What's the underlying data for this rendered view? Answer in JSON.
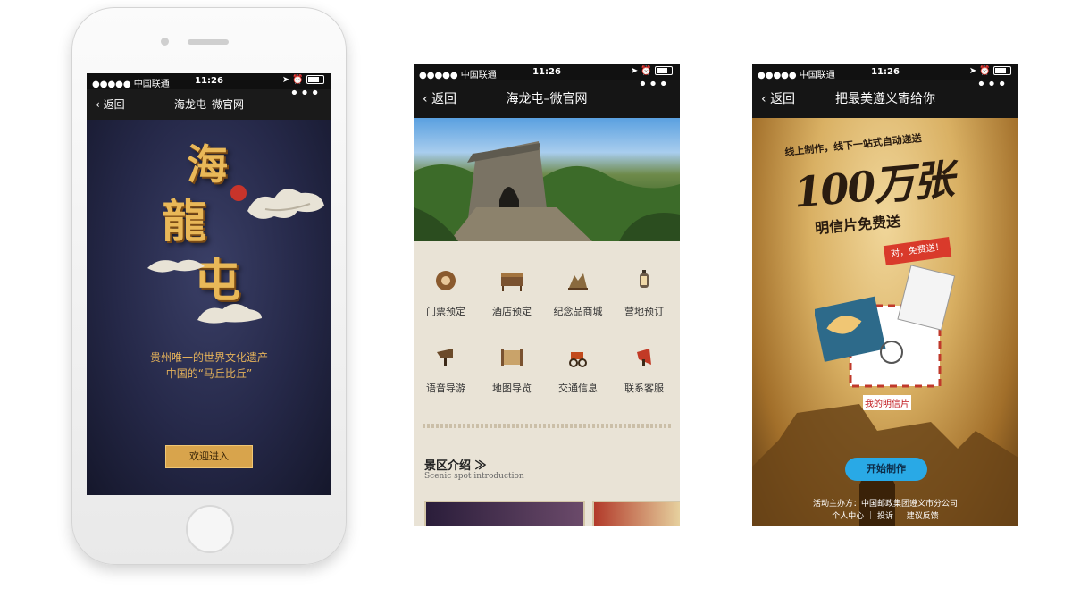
{
  "status": {
    "carrier": "●●●●● 中国联通",
    "time": "11:26"
  },
  "screen1": {
    "back": "返回",
    "title": "海龙屯–微官网",
    "more": "•••",
    "chars": [
      "海",
      "龍",
      "屯"
    ],
    "tagline1": "贵州唯一的世界文化遗产",
    "tagline2": "中国的“马丘比丘”",
    "enter_button": "欢迎进入"
  },
  "screen2": {
    "back": "返回",
    "title": "海龙屯–微官网",
    "more": "•••",
    "menu": [
      {
        "label": "门票预定",
        "icon": "ticket-icon"
      },
      {
        "label": "酒店预定",
        "icon": "bed-icon"
      },
      {
        "label": "纪念品商城",
        "icon": "souvenir-icon"
      },
      {
        "label": "营地预订",
        "icon": "lantern-icon"
      },
      {
        "label": "语音导游",
        "icon": "horn-icon"
      },
      {
        "label": "地图导览",
        "icon": "scroll-map-icon"
      },
      {
        "label": "交通信息",
        "icon": "carriage-icon"
      },
      {
        "label": "联系客服",
        "icon": "megaphone-icon"
      }
    ],
    "section_title": "景区介绍",
    "section_subtitle": "Scenic spot introduction"
  },
  "screen3": {
    "back": "返回",
    "title": "把最美遵义寄给你",
    "more": "•••",
    "headline_small": "线上制作，线下一站式自动递送",
    "headline_big": "100万张",
    "headline_sub": "明信片免费送",
    "stamp": "对，免费送！",
    "my_postcard": "我的明信片",
    "start_button": "开始制作",
    "organizer": "活动主办方：中国邮政集团遵义市分公司",
    "footer_links": "个人中心 ｜ 投诉 ｜ 建议反馈"
  }
}
